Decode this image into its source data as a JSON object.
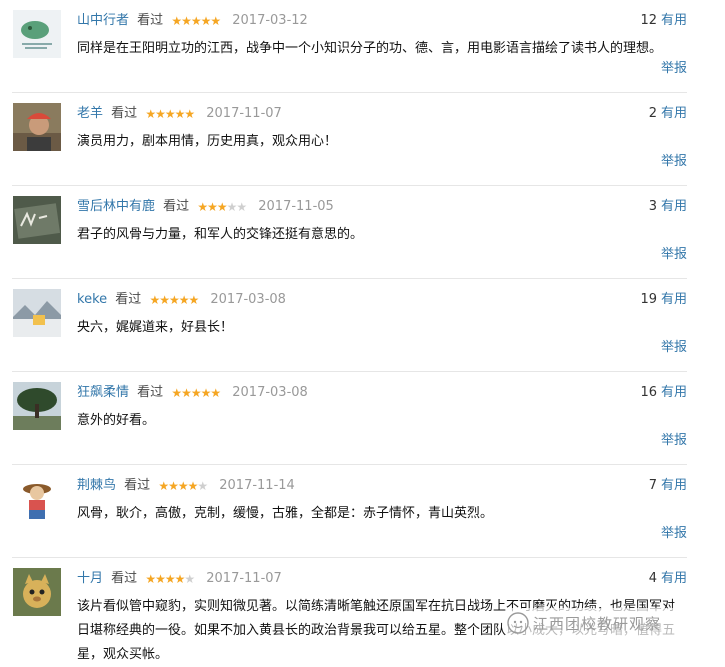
{
  "reviews": [
    {
      "user": "山中行者",
      "action": "看过",
      "stars": "★★★★★",
      "stars_off": "",
      "rating": 5,
      "date": "2017-03-12",
      "useful_count": "12",
      "useful_label": "有用",
      "content": "同样是在王阳明立功的江西，战争中一个小知识分子的功、德、言，用电影语言描绘了读书人的理想。",
      "report": "举报",
      "avatar": "avatar-sticker-icon"
    },
    {
      "user": "老羊",
      "action": "看过",
      "stars": "★★★★★",
      "stars_off": "",
      "rating": 5,
      "date": "2017-11-07",
      "useful_count": "2",
      "useful_label": "有用",
      "content": "演员用力，剧本用情，历史用真，观众用心！",
      "report": "举报",
      "avatar": "avatar-person-icon"
    },
    {
      "user": "雪后林中有鹿",
      "action": "看过",
      "stars": "★★★",
      "stars_off": "★★",
      "rating": 3,
      "date": "2017-11-05",
      "useful_count": "3",
      "useful_label": "有用",
      "content": "君子的风骨与力量，和军人的交锋还挺有意思的。",
      "report": "举报",
      "avatar": "avatar-chalkboard-icon"
    },
    {
      "user": "keke",
      "action": "看过",
      "stars": "★★★★★",
      "stars_off": "",
      "rating": 5,
      "date": "2017-03-08",
      "useful_count": "19",
      "useful_label": "有用",
      "content": "央六，娓娓道来，好县长！",
      "report": "举报",
      "avatar": "avatar-landscape-icon"
    },
    {
      "user": "狂飙柔情",
      "action": "看过",
      "stars": "★★★★★",
      "stars_off": "",
      "rating": 5,
      "date": "2017-03-08",
      "useful_count": "16",
      "useful_label": "有用",
      "content": "意外的好看。",
      "report": "举报",
      "avatar": "avatar-tree-icon"
    },
    {
      "user": "荆棘鸟",
      "action": "看过",
      "stars": "★★★★",
      "stars_off": "★",
      "rating": 4,
      "date": "2017-11-14",
      "useful_count": "7",
      "useful_label": "有用",
      "content": "风骨，耿介，高傲，克制，缓慢，古雅，全都是：赤子情怀，青山英烈。",
      "report": "举报",
      "avatar": "avatar-doll-icon"
    },
    {
      "user": "十月",
      "action": "看过",
      "stars": "★★★★",
      "stars_off": "★",
      "rating": 4,
      "date": "2017-11-07",
      "useful_count": "4",
      "useful_label": "有用",
      "content": "该片看似管中窥豹，实则知微见著。以简练清晰笔触还原国军在抗日战场上不可磨灭的功绩，也是国军对日堪称经典的一役。如果不加入黄县长的政治背景我可以给五星。整个团队以小成大，以光写暗，值得五星，观众买帐。",
      "report": "",
      "avatar": "avatar-cat-icon"
    }
  ],
  "watermark": {
    "text": "江西团校教研观察",
    "icon": "wechat-icon"
  }
}
